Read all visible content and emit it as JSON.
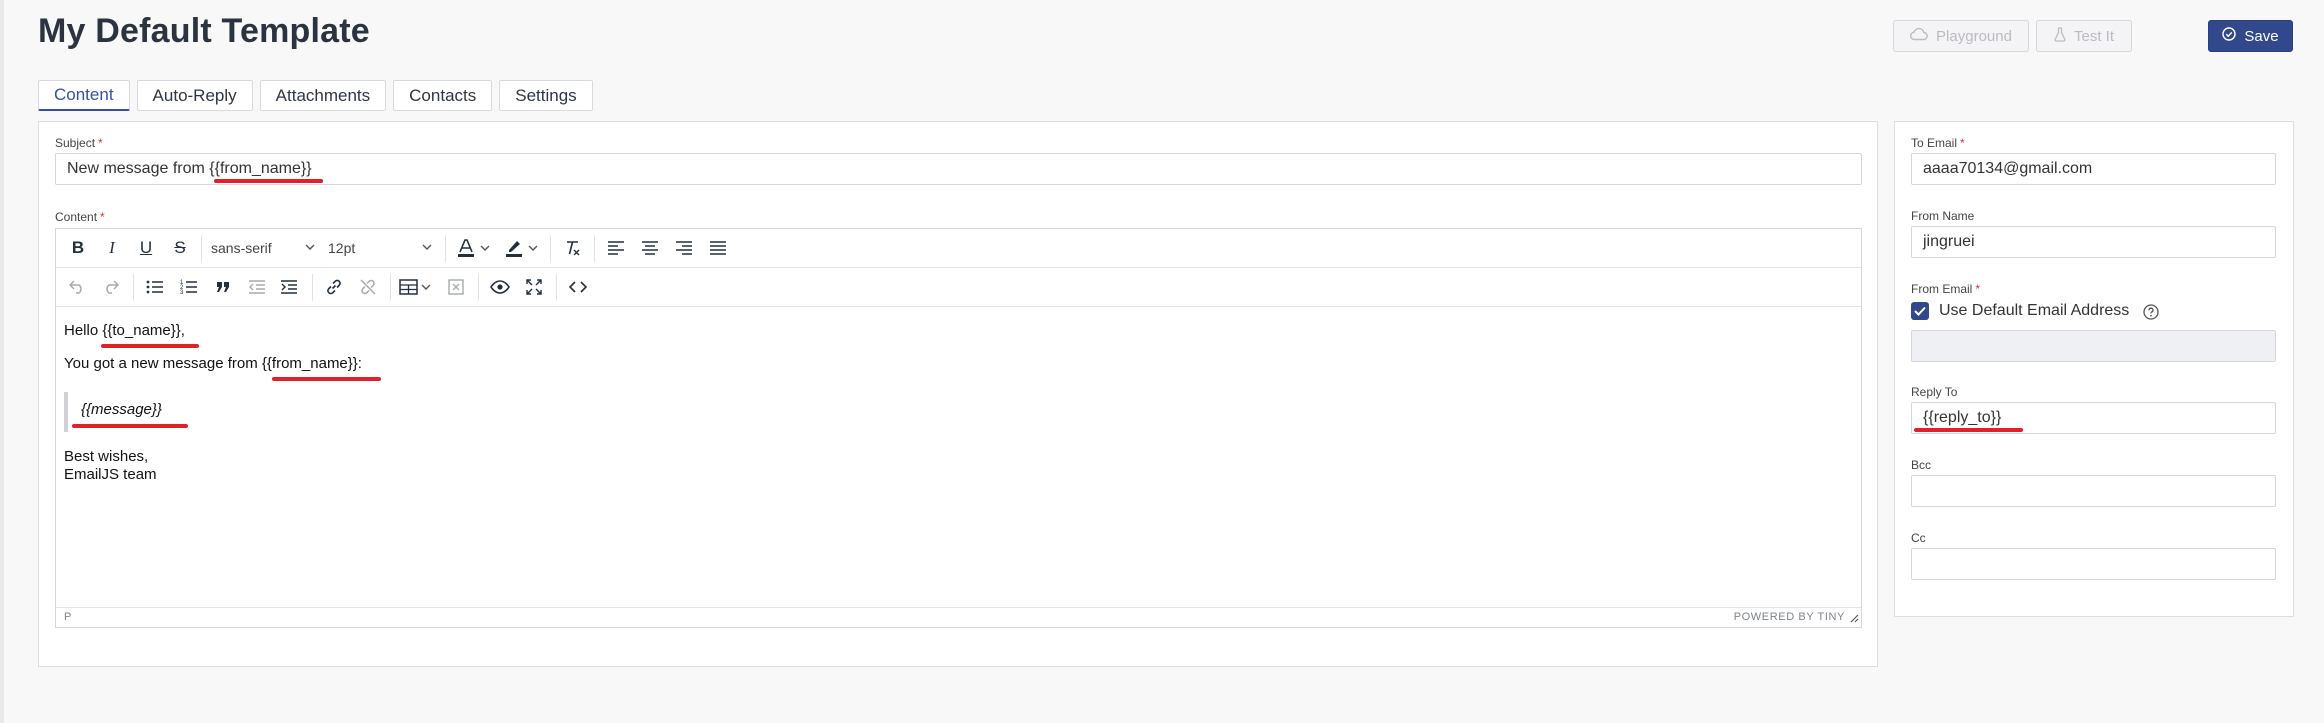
{
  "header": {
    "title": "My Default Template",
    "playground_label": "Playground",
    "test_label": "Test It",
    "save_label": "Save"
  },
  "tabs": [
    {
      "label": "Content",
      "active": true
    },
    {
      "label": "Auto-Reply",
      "active": false
    },
    {
      "label": "Attachments",
      "active": false
    },
    {
      "label": "Contacts",
      "active": false
    },
    {
      "label": "Settings",
      "active": false
    }
  ],
  "content": {
    "subject_label": "Subject",
    "subject_value": "New message from {{from_name}}",
    "content_label": "Content",
    "required_mark": "*"
  },
  "toolbar": {
    "font_family": "sans-serif",
    "font_size": "12pt"
  },
  "editor": {
    "line1": "Hello {{to_name}},",
    "line2": "You got a new message from {{from_name}}:",
    "line3": "{{message}}",
    "line4": "Best wishes,",
    "line5": "EmailJS team",
    "status_path": "P",
    "powered_by": "POWERED BY TINY"
  },
  "side": {
    "to_email_label": "To Email",
    "to_email_value": "aaaa70134@gmail.com",
    "from_name_label": "From Name",
    "from_name_value": "jingruei",
    "from_email_label": "From Email",
    "use_default_label": "Use Default Email Address",
    "use_default_checked": true,
    "reply_to_label": "Reply To",
    "reply_to_value": "{{reply_to}}",
    "bcc_label": "Bcc",
    "cc_label": "Cc"
  },
  "colors": {
    "accent": "#31498c",
    "highlight_underline": "#e0202a"
  }
}
